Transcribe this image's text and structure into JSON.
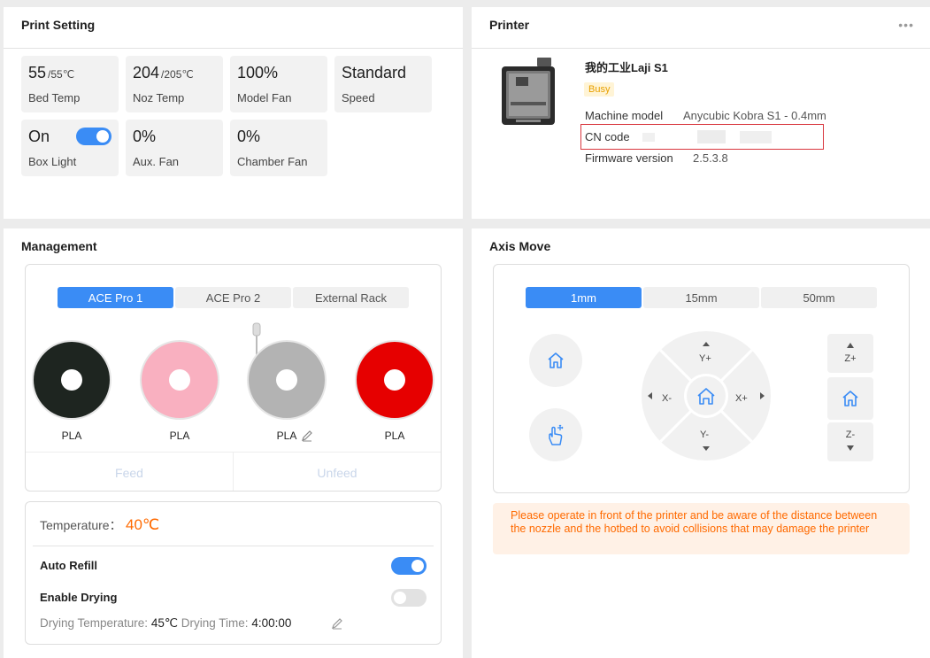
{
  "print_setting": {
    "title": "Print Setting",
    "tiles": [
      {
        "value": "55",
        "sub": "/55℃",
        "label": "Bed Temp"
      },
      {
        "value": "204",
        "sub": "/205℃",
        "label": "Noz Temp"
      },
      {
        "value": "100%",
        "sub": "",
        "label": "Model Fan"
      },
      {
        "value": "Standard",
        "sub": "",
        "label": "Speed"
      },
      {
        "value": "On",
        "sub": "",
        "label": "Box Light"
      },
      {
        "value": "0%",
        "sub": "",
        "label": "Aux. Fan"
      },
      {
        "value": "0%",
        "sub": "",
        "label": "Chamber Fan"
      }
    ],
    "box_light_on": true
  },
  "printer": {
    "title": "Printer",
    "more_icon": "more-dots-icon",
    "name": "我的工业Laji S1",
    "status": "Busy",
    "machine_model_label": "Machine model",
    "machine_model_value": "Anycubic Kobra S1 - 0.4mm",
    "cn_code_label": "CN code",
    "firmware_label": "Firmware version",
    "firmware_value": "2.5.3.8"
  },
  "management": {
    "title": "Management",
    "tabs": [
      "ACE Pro 1",
      "ACE Pro 2",
      "External Rack"
    ],
    "active_tab": 0,
    "spools": [
      {
        "type": "PLA",
        "color": "#1e2520"
      },
      {
        "type": "PLA",
        "color": "#f9b0c0"
      },
      {
        "type": "PLA",
        "color": "#b3b3b3"
      },
      {
        "type": "PLA",
        "color": "#e60000"
      }
    ],
    "feed_label": "Feed",
    "unfeed_label": "Unfeed",
    "temperature_label": "Temperature：",
    "temperature_value": "40℃",
    "auto_refill_label": "Auto Refill",
    "auto_refill_on": true,
    "enable_drying_label": "Enable Drying",
    "enable_drying_on": false,
    "drying_temp_label": "Drying Temperature:",
    "drying_temp_value": "45℃",
    "drying_time_label": "Drying Time:",
    "drying_time_value": "4:00:00"
  },
  "axis_move": {
    "title": "Axis Move",
    "steps": [
      "1mm",
      "15mm",
      "50mm"
    ],
    "active_step": 0,
    "y_plus": "Y+",
    "y_minus": "Y-",
    "x_plus": "X+",
    "x_minus": "X-",
    "z_plus": "Z+",
    "z_minus": "Z-",
    "warning": "Please operate in front of the printer and be aware of the distance between the nozzle and the hotbed to avoid collisions that may damage the printer"
  },
  "colors": {
    "accent": "#3a8cf5",
    "warning": "#ff6a00",
    "busy": "#e8a000"
  }
}
